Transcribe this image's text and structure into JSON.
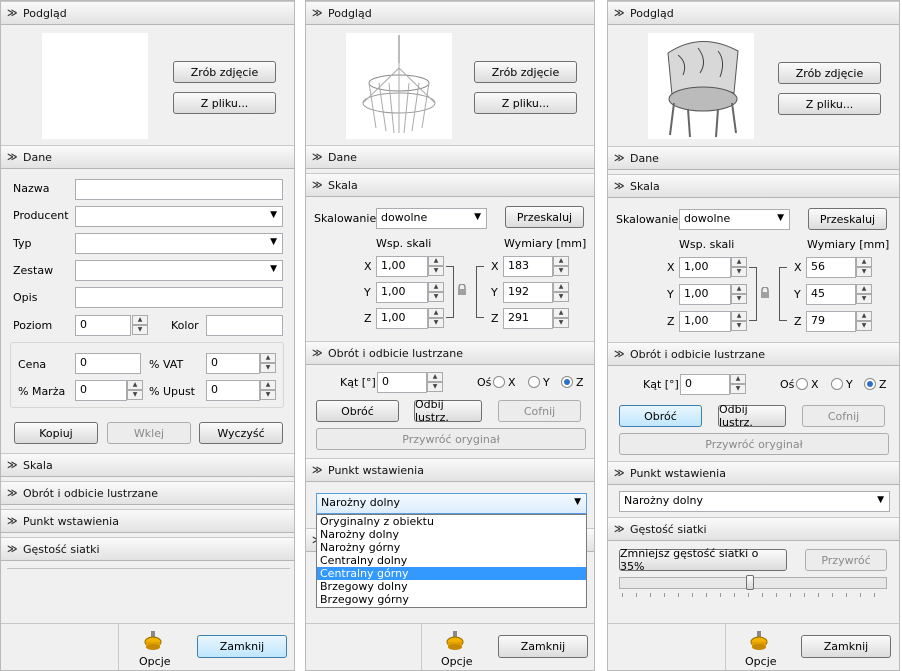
{
  "colors": {
    "selected_item": "#3399ff",
    "radio_dot": "#2a6fc9",
    "highlight_button": "#bee6fd"
  },
  "common": {
    "preview": "Podgląd",
    "take_photo": "Zrób zdjęcie",
    "from_file": "Z pliku...",
    "data": "Dane",
    "scale": "Skala",
    "rotate_mirror": "Obrót i odbicie lustrzane",
    "insertion_point": "Punkt wstawienia",
    "mesh_density": "Gęstość siatki",
    "options": "Opcje",
    "close": "Zamknij",
    "scaling": "Skalowanie",
    "scaling_value": "dowolne",
    "rescale": "Przeskaluj",
    "scale_factor": "Wsp. skali",
    "dimensions": "Wymiary [mm]",
    "axis_x": "X",
    "axis_y": "Y",
    "axis_z": "Z",
    "angle": "Kąt [°]",
    "angle_value": "0",
    "axis_label": "Oś",
    "rotate": "Obróć",
    "mirror": "Odbij lustrz.",
    "undo": "Cofnij",
    "restore": "Przywróć oryginał",
    "corner_bottom": "Narożny dolny",
    "reduce_density": "Zmniejsz gęstość siatki o 35%",
    "restore_short": "Przywróć"
  },
  "panel1": {
    "fields": {
      "name": "Nazwa",
      "producer": "Producent",
      "type": "Typ",
      "set": "Zestaw",
      "desc": "Opis",
      "level": "Poziom",
      "level_value": "0",
      "color": "Kolor"
    },
    "price": {
      "price": "Cena",
      "price_value": "0",
      "vat": "% VAT",
      "vat_value": "0",
      "margin": "% Marża",
      "margin_value": "0",
      "discount": "% Upust",
      "discount_value": "0"
    },
    "buttons": {
      "copy": "Kopiuj",
      "paste": "Wklej",
      "clear": "Wyczyść"
    }
  },
  "panel2": {
    "scale_values": [
      "1,00",
      "1,00",
      "1,00"
    ],
    "dims": [
      "183",
      "192",
      "291"
    ],
    "dropdown": [
      "Oryginalny z obiektu",
      "Narożny dolny",
      "Narożny górny",
      "Centralny dolny",
      "Centralny górny",
      "Brzegowy dolny",
      "Brzegowy górny"
    ],
    "dropdown_selected": 4
  },
  "panel3": {
    "scale_values": [
      "1,00",
      "1,00",
      "1,00"
    ],
    "dims": [
      "56",
      "45",
      "79"
    ],
    "slider_value_fraction": 0.49
  }
}
